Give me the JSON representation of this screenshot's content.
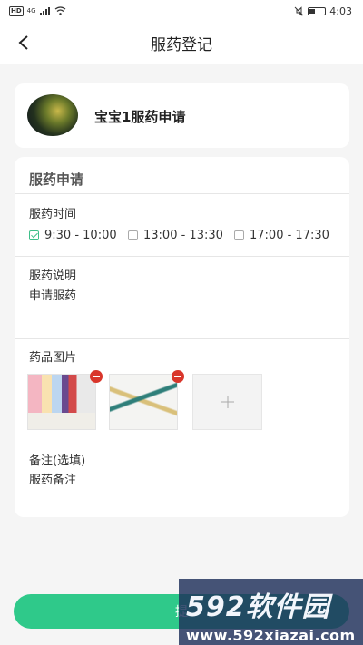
{
  "status_bar": {
    "network_badge": "HD",
    "network_type": "4G",
    "time": "4:03"
  },
  "header": {
    "title": "服药登记",
    "back_icon": "chevron-left-icon"
  },
  "request_card": {
    "title": "宝宝1服药申请"
  },
  "form": {
    "section_title": "服药申请",
    "time_label": "服药时间",
    "time_options": [
      {
        "label": "9:30 - 10:00",
        "checked": true
      },
      {
        "label": "13:00 - 13:30",
        "checked": false
      },
      {
        "label": "17:00 - 17:30",
        "checked": false
      }
    ],
    "instructions_label": "服药说明",
    "instructions_value": "申请服药",
    "images_label": "药品图片",
    "notes_label": "备注(选填)",
    "notes_value": "服药备注"
  },
  "submit_label": "提",
  "watermark": {
    "main": "592软件园",
    "url": "www.592xiazai.com"
  },
  "colors": {
    "accent": "#2fc98a",
    "remove_badge": "#d9362b",
    "background": "#f5f5f5"
  }
}
